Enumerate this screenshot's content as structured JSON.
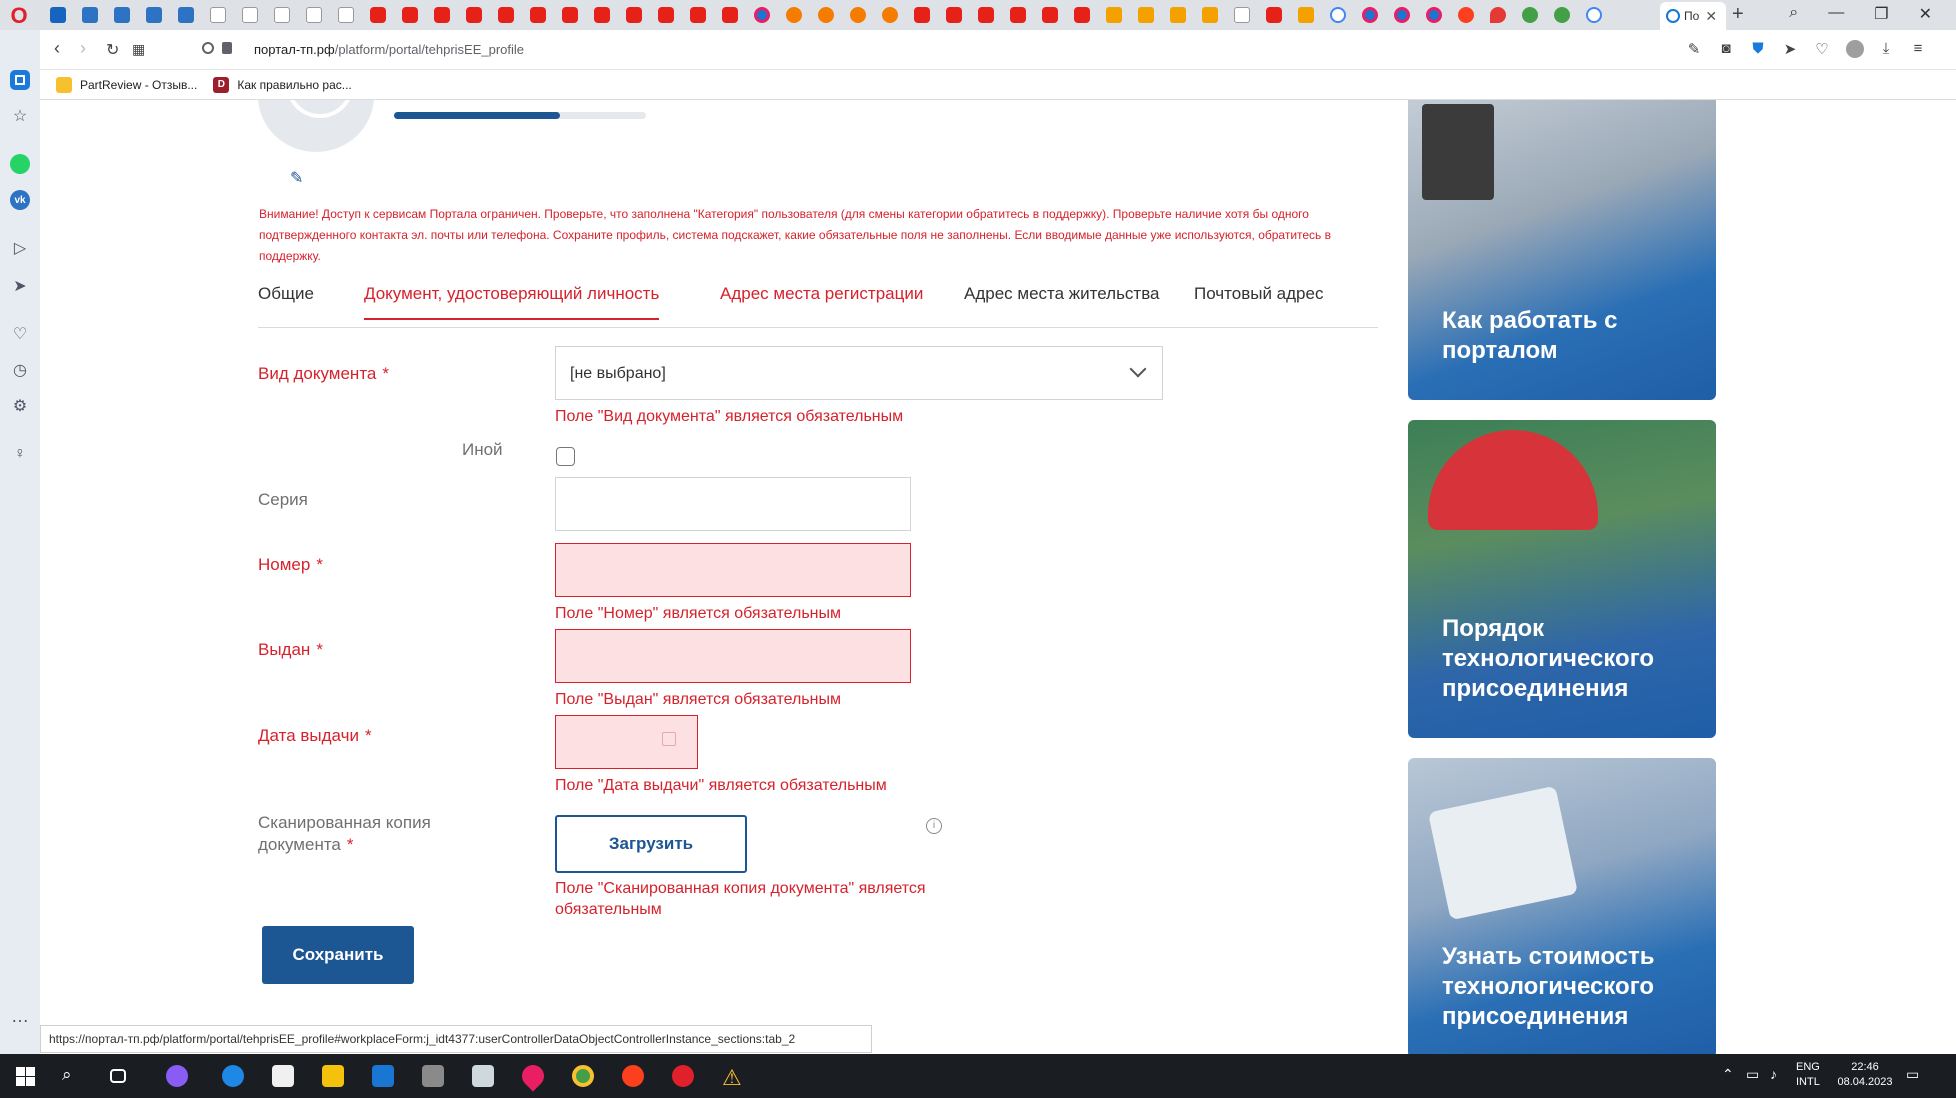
{
  "browser": {
    "active_tab_label": "По",
    "address": {
      "host": "портал-тп.рф",
      "path": "/platform/portal/tehprisEE_profile"
    },
    "bookmarks": [
      {
        "label": "PartReview - Отзыв..."
      },
      {
        "label": "Как правильно рас..."
      }
    ],
    "status_url": "https://портал-тп.рф/platform/portal/tehprisEE_profile#workplaceForm:j_idt4377:userControllerDataObjectControllerInstance_sections:tab_2"
  },
  "profile": {
    "completeness_fraction": 0.66
  },
  "warning_text": "Внимание! Доступ к сервисам Портала ограничен. Проверьте, что заполнена \"Категория\" пользователя (для смены категории обратитесь в поддержку). Проверьте наличие хотя бы одного подтвержденного контакта эл. почты или телефона. Сохраните профиль, система подскажет, какие обязательные поля не заполнены. Если вводимые данные уже используются, обратитесь в поддержку.",
  "tabs": [
    {
      "label": "Общие"
    },
    {
      "label": "Документ, удостоверяющий личность"
    },
    {
      "label": "Адрес места регистрации"
    },
    {
      "label": "Адрес места жительства"
    },
    {
      "label": "Почтовый адрес"
    }
  ],
  "form": {
    "doc_type": {
      "label": "Вид документа",
      "value": "[не выбрано]",
      "error": "Поле \"Вид документа\" является обязательным"
    },
    "other": {
      "label": "Иной"
    },
    "series": {
      "label": "Серия"
    },
    "number": {
      "label": "Номер",
      "error": "Поле \"Номер\" является обязательным"
    },
    "issued_by": {
      "label": "Выдан",
      "error": "Поле \"Выдан\" является обязательным"
    },
    "issue_date": {
      "label": "Дата выдачи",
      "error": "Поле \"Дата выдачи\" является обязательным"
    },
    "scan": {
      "label_line1": "Сканированная копия",
      "label_line2": "документа",
      "upload_label": "Загрузить",
      "error_line1": "Поле \"Сканированная копия документа\" является",
      "error_line2": "обязательным"
    },
    "required_mark": "*",
    "save_label": "Сохранить"
  },
  "cards": [
    {
      "line1": "Как работать с",
      "line2": "порталом",
      "line3": ""
    },
    {
      "line1": "Порядок",
      "line2": "технологического",
      "line3": "присоединения"
    },
    {
      "line1": "Узнать стоимость",
      "line2": "технологического",
      "line3": "присоединения"
    }
  ],
  "taskbar": {
    "lang_line1": "ENG",
    "lang_line2": "INTL",
    "time": "22:46",
    "date": "08.04.2023"
  },
  "colors": {
    "accent_red": "#d6222c",
    "brand_blue": "#1c5693",
    "error_bg": "#fde0e2"
  }
}
